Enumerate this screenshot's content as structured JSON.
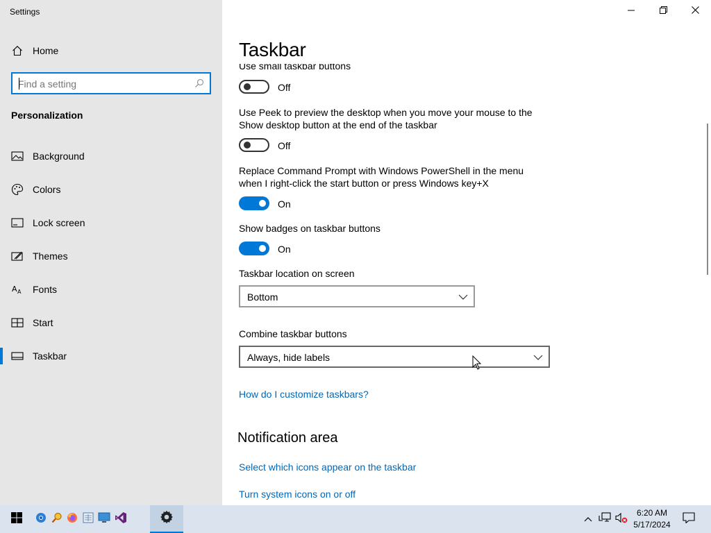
{
  "window": {
    "title": "Settings",
    "minimize_icon": "minimize-icon",
    "restore_icon": "restore-icon",
    "close_icon": "close-icon"
  },
  "sidebar": {
    "home_label": "Home",
    "search_placeholder": "Find a setting",
    "section_heading": "Personalization",
    "items": [
      {
        "label": "Background",
        "icon": "picture-icon"
      },
      {
        "label": "Colors",
        "icon": "palette-icon"
      },
      {
        "label": "Lock screen",
        "icon": "lock-screen-icon"
      },
      {
        "label": "Themes",
        "icon": "themes-icon"
      },
      {
        "label": "Fonts",
        "icon": "fonts-icon"
      },
      {
        "label": "Start",
        "icon": "start-icon"
      },
      {
        "label": "Taskbar",
        "icon": "taskbar-icon"
      }
    ],
    "selected": "Taskbar"
  },
  "main": {
    "title": "Taskbar",
    "partial_setting_label": "Use small taskbar buttons",
    "settings": [
      {
        "label": "Use small taskbar buttons",
        "state": "Off",
        "on": false
      },
      {
        "label": "Use Peek to preview the desktop when you move your mouse to the Show desktop button at the end of the taskbar",
        "state": "Off",
        "on": false
      },
      {
        "label": "Replace Command Prompt with Windows PowerShell in the menu when I right-click the start button or press Windows key+X",
        "state": "On",
        "on": true
      },
      {
        "label": "Show badges on taskbar buttons",
        "state": "On",
        "on": true
      }
    ],
    "location": {
      "label": "Taskbar location on screen",
      "value": "Bottom"
    },
    "combine": {
      "label": "Combine taskbar buttons",
      "value": "Always, hide labels"
    },
    "help_link": "How do I customize taskbars?",
    "notification_area": {
      "heading": "Notification area",
      "links": [
        "Select which icons appear on the taskbar",
        "Turn system icons on or off"
      ]
    }
  },
  "taskbar": {
    "pinned": [
      "windows-start-icon",
      "chrome-icon",
      "search-magnifier-icon",
      "firefox-icon",
      "network-map-icon",
      "remote-desktop-icon",
      "visual-studio-icon",
      "settings-gear-icon"
    ],
    "clock": {
      "time": "6:20 AM",
      "date": "5/17/2024"
    },
    "tray": [
      "show-hidden-icons-icon",
      "network-icon",
      "volume-muted-icon",
      "notification-icon"
    ]
  },
  "colors": {
    "accent": "#0078d7",
    "link": "#0067b8",
    "sidebar_bg": "#e6e6e6",
    "taskbar_bg": "#dbe4ee"
  }
}
